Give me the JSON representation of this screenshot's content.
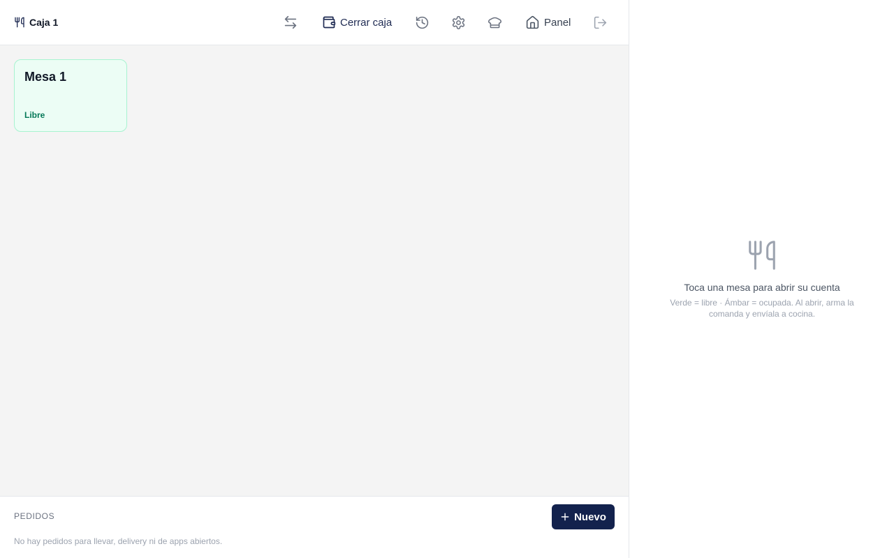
{
  "header": {
    "title": "Caja 1",
    "close_register_label": "Cerrar caja",
    "panel_label": "Panel"
  },
  "icons": {
    "brand": "utensils-icon",
    "switch": "arrows-left-right-icon",
    "close_register": "wallet-icon",
    "history": "history-icon",
    "settings": "gear-icon",
    "kitchen": "chef-hat-icon",
    "home": "home-icon",
    "logout": "logout-icon",
    "new": "plus-icon",
    "empty": "utensils-icon"
  },
  "tables": [
    {
      "name": "Mesa 1",
      "status": "Libre"
    }
  ],
  "orders": {
    "title": "PEDIDOS",
    "new_label": "Nuevo",
    "empty_text": "No hay pedidos para llevar, delivery ni de apps abiertos."
  },
  "detail": {
    "empty_title": "Toca una mesa para abrir su cuenta",
    "empty_hint": "Verde = libre · Ámbar = ocupada. Al abrir, arma la comanda y envíala a cocina."
  },
  "colors": {
    "primary": "#13224d",
    "free_bg": "#ecfdf5",
    "free_border": "#a7f3d0",
    "free_text": "#047857"
  }
}
